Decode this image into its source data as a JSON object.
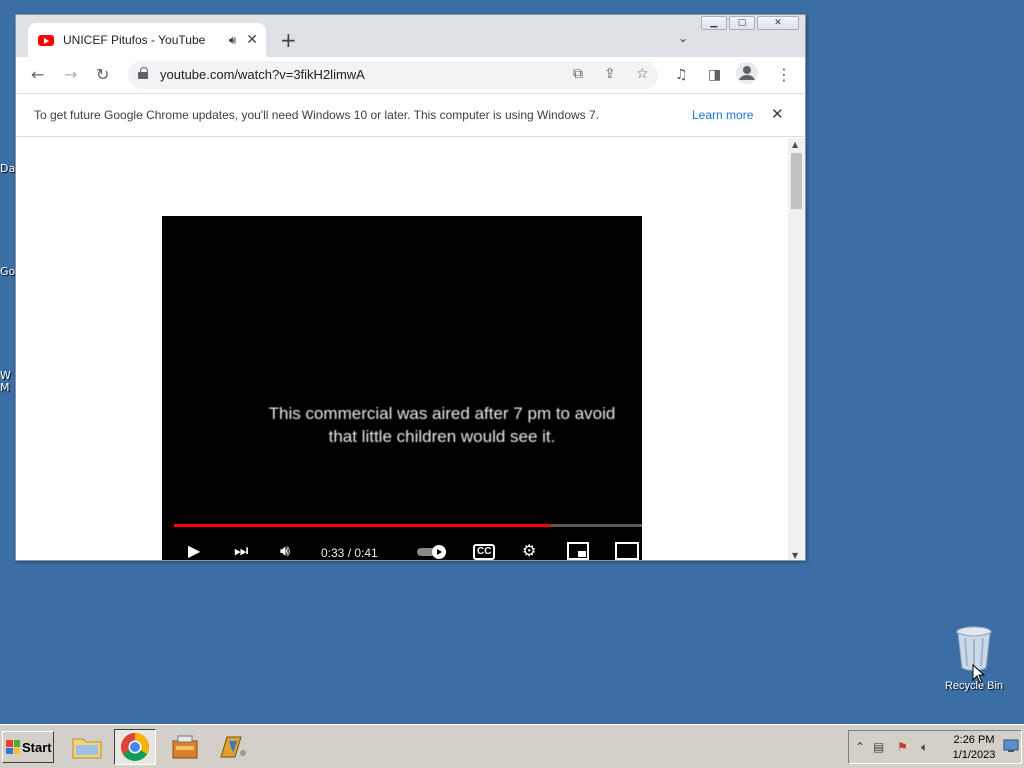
{
  "desktop": {
    "clipped_labels": [
      "Da",
      "Go",
      "W",
      "M"
    ],
    "recycle_bin_label": "Recycle Bin"
  },
  "browser": {
    "tab_title": "UNICEF Pitufos - YouTube",
    "new_tab_symbol": "+",
    "url": "youtube.com/watch?v=3fikH2limwA",
    "infobar": {
      "message": "To get future Google Chrome updates, you'll need Windows 10 or later. This computer is using Windows 7.",
      "link_label": "Learn more"
    },
    "video": {
      "caption_line1": "This commercial was aired after 7 pm to avoid",
      "caption_line2": "that little children would see it.",
      "time_label": "0:33 / 0:41",
      "cc_label": "CC",
      "progress_fraction": 0.805
    }
  },
  "taskbar": {
    "start_label": "Start",
    "clock_time": "2:26 PM",
    "clock_date": "1/1/2023"
  },
  "colors": {
    "desktop": "#3a6ea5",
    "youtube_red": "#ff0000",
    "link_blue": "#1a73e8"
  }
}
